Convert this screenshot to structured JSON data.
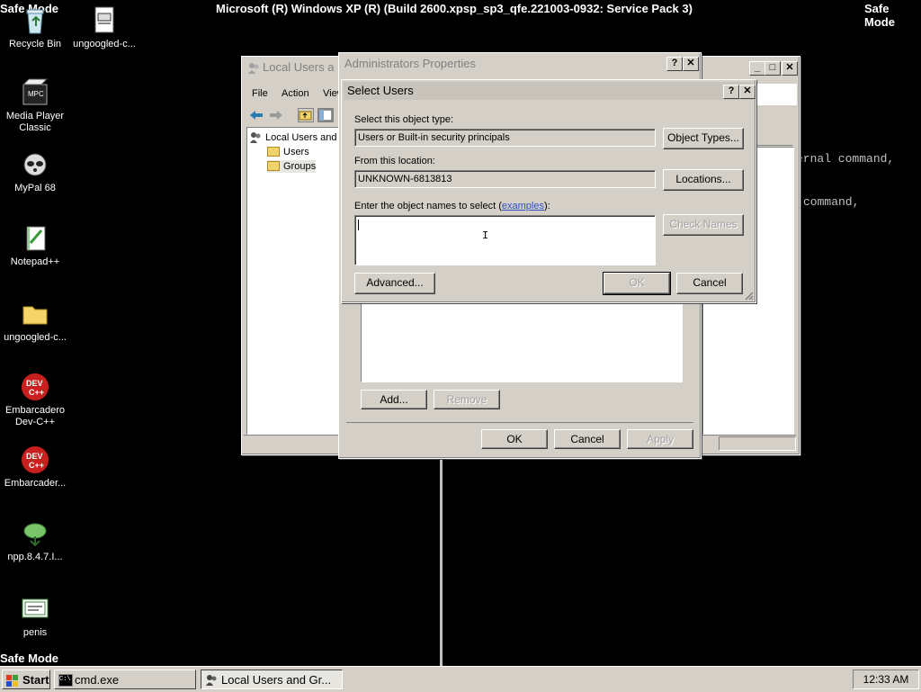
{
  "banners": {
    "top_left": "Safe Mode",
    "top_center": "Microsoft (R) Windows XP (R) (Build 2600.xpsp_sp3_qfe.221003-0932: Service Pack 3)",
    "top_right": "Safe Mode",
    "bottom_left": "Safe Mode"
  },
  "desktop_icons": [
    {
      "label": "Recycle Bin"
    },
    {
      "label": "ungoogled-c..."
    },
    {
      "label": "Media Player Classic"
    },
    {
      "label": "MyPal 68"
    },
    {
      "label": "Notepad++"
    },
    {
      "label": "ungoogled-c..."
    },
    {
      "label": "Embarcadero Dev-C++"
    },
    {
      "label": "Embarcader..."
    },
    {
      "label": "npp.8.4.7.I..."
    },
    {
      "label": "penis"
    }
  ],
  "console": {
    "line1": "ernal command,",
    "line2": "command,"
  },
  "lusrmgr": {
    "title": "Local Users a",
    "menu": [
      "File",
      "Action",
      "View"
    ],
    "tree": {
      "root": "Local Users and",
      "users": "Users",
      "groups": "Groups"
    }
  },
  "admin_props": {
    "title": "Administrators Properties",
    "add_label": "Add...",
    "remove_label": "Remove",
    "ok_label": "OK",
    "cancel_label": "Cancel",
    "apply_label": "Apply"
  },
  "select_users": {
    "title": "Select Users",
    "object_type_label": "Select this object type:",
    "object_type_value": "Users or Built-in security principals",
    "object_types_button": "Object Types...",
    "location_label": "From this location:",
    "location_value": "UNKNOWN-6813813",
    "locations_button": "Locations...",
    "names_label_prefix": "Enter the object names to select (",
    "names_label_link": "examples",
    "names_label_suffix": "):",
    "names_value": "",
    "check_names_button": "Check Names",
    "advanced_button": "Advanced...",
    "ok_button": "OK",
    "cancel_button": "Cancel"
  },
  "taskbar": {
    "start_label": "Start",
    "tasks": [
      "cmd.exe",
      "Local Users and Gr..."
    ],
    "clock": "12:33 AM"
  }
}
